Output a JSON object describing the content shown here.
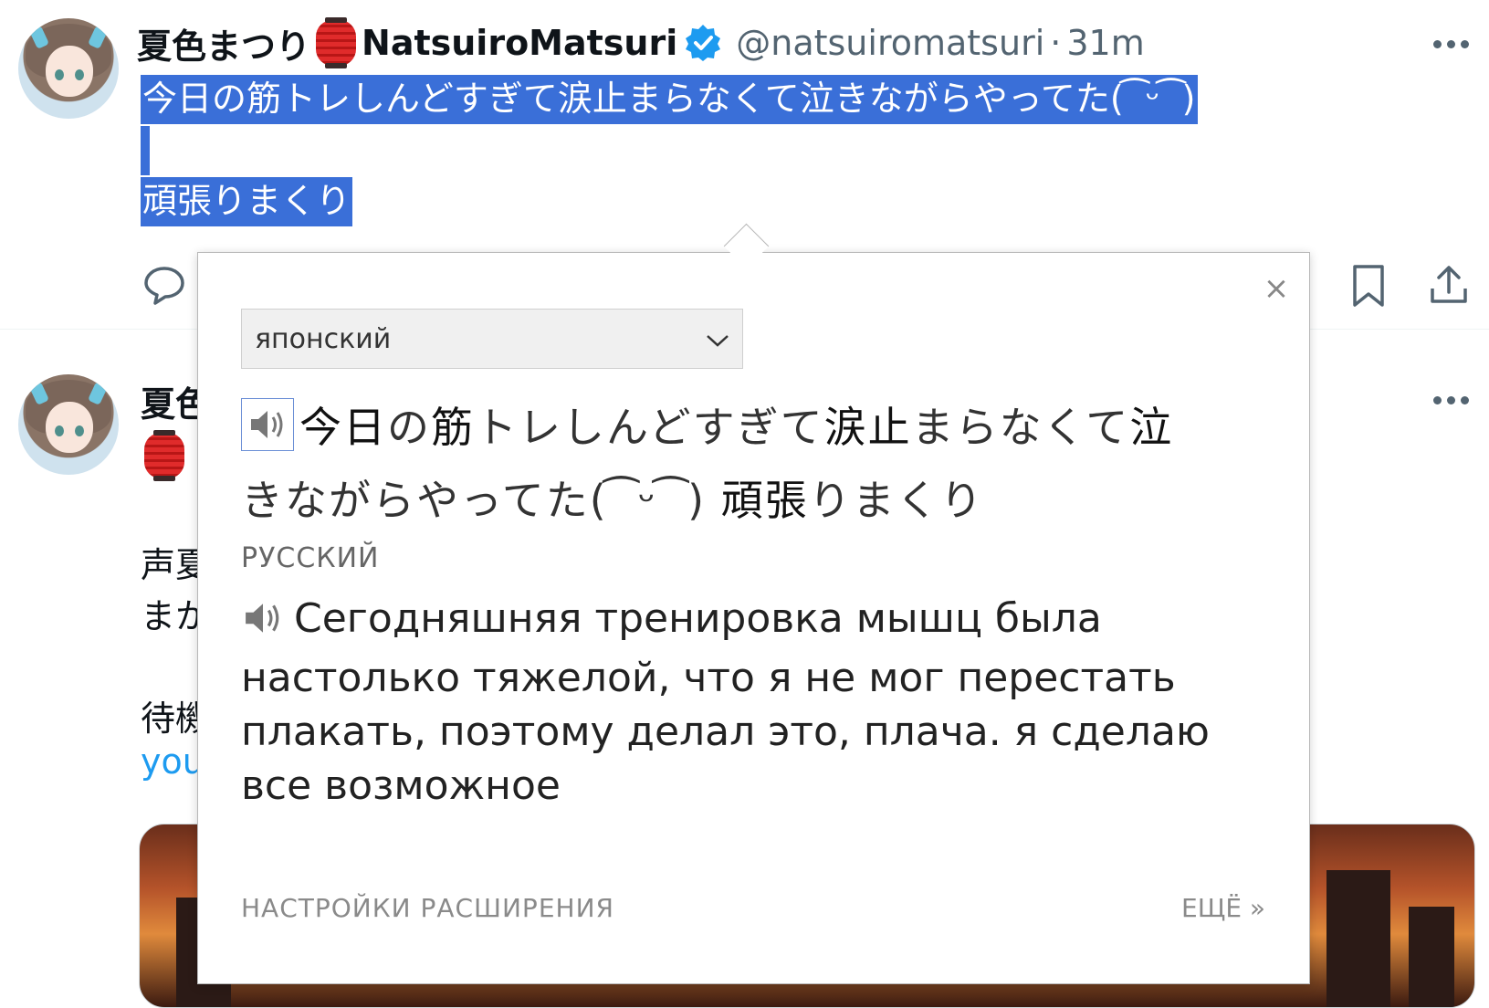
{
  "tweet1": {
    "display_name": "夏色まつり",
    "name_suffix": "NatsuiroMatsuri",
    "handle": "@natsuiromatsuri",
    "separator": "·",
    "time": "31m",
    "line1": "今日の筋トレしんどすぎて涙止まらなくて泣きながらやってた(  ͡ ᵕ ͡ )",
    "line3": "頑張りまくり"
  },
  "tweet2": {
    "display_name_partial": "夏色",
    "text_line1_partial": "声夏",
    "text_line2_partial": "まか",
    "text_line3_partial": "待機",
    "link_partial": "you"
  },
  "popup": {
    "source_language": "японский",
    "source_text_line1_words": [
      "今日",
      "の",
      "筋",
      "トレしんどすぎて",
      "涙止",
      "まらなくて",
      "泣"
    ],
    "source_text_line2_words": [
      "きながらやってた(  ͡ ᵕ ͡ ) ",
      "頑張",
      "りまくり"
    ],
    "target_language_label": "РУССКИЙ",
    "translation": "Сегодняшняя тренировка мышц была настолько тяжелой, что я не мог перестать плакать, поэтому делал это, плача. я сделаю все возможное",
    "close_symbol": "×",
    "settings_link": "НАСТРОЙКИ РАСШИРЕНИЯ",
    "more_link": "ЕЩЁ »"
  },
  "colors": {
    "selection": "#3a6fd8",
    "verified": "#1d9bf0",
    "link": "#1d9bf0",
    "muted": "#536471"
  },
  "icons": [
    "avatar",
    "lantern-emoji",
    "verified-badge-icon",
    "more-icon",
    "reply-icon",
    "bookmark-icon",
    "share-icon",
    "close-icon",
    "chevron-down-icon",
    "speaker-icon"
  ]
}
